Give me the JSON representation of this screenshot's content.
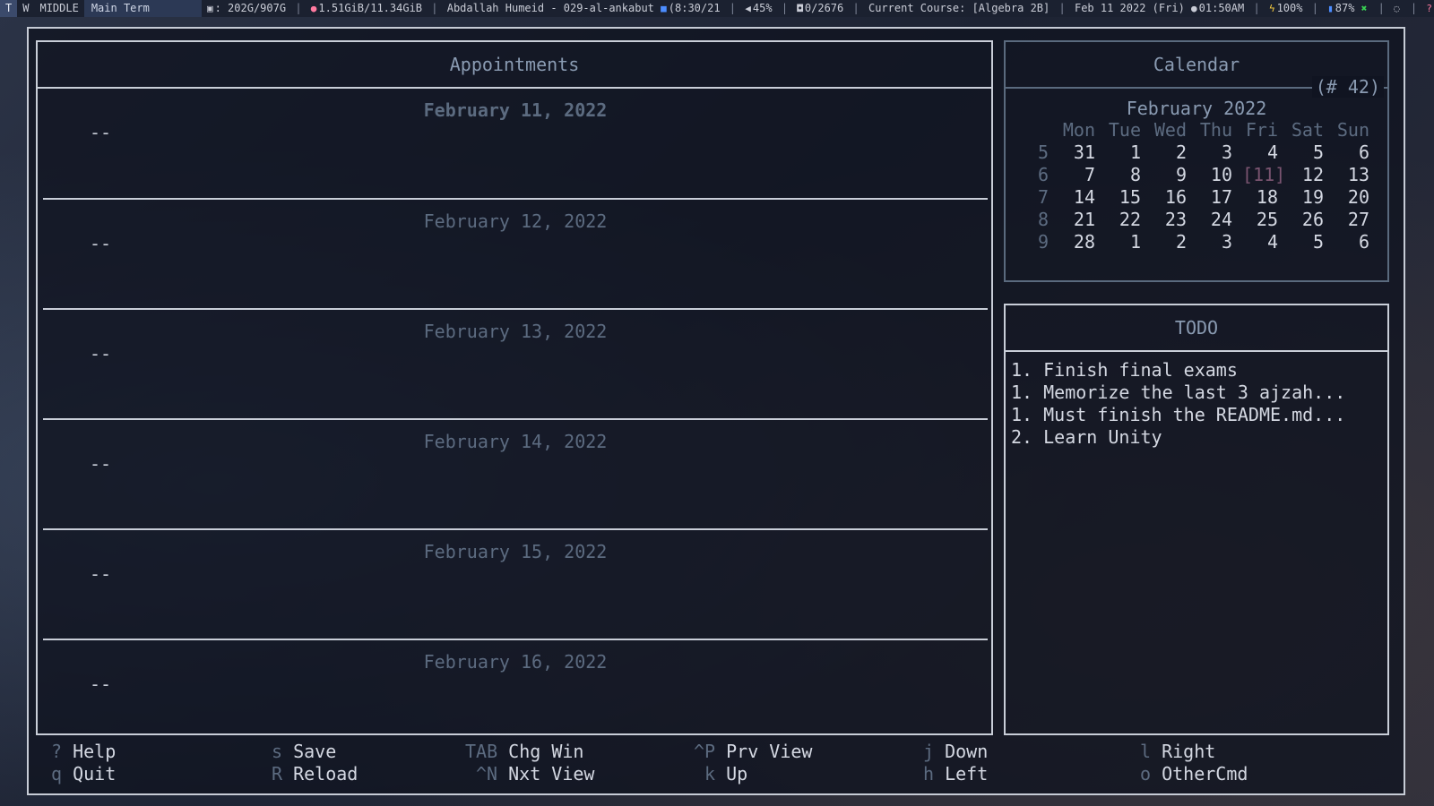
{
  "topbar": {
    "workspaces": [
      "T",
      "W",
      "MIDDLE"
    ],
    "window_title": "Main Term",
    "disk": ": 202G/907G",
    "memory": "1.51GiB/11.34GiB",
    "now_playing": "Abdallah Humeid - 029-al-ankabut",
    "track_time": "(8:30/21",
    "volume": "45%",
    "counter": "0/2676",
    "course": "Current Course: [Algebra 2B]",
    "date": "Feb 11 2022 (Fri)",
    "time": "01:50AM",
    "battery": "100%",
    "wifi": "87%",
    "separator": "|"
  },
  "appointments": {
    "title": "Appointments",
    "days": [
      {
        "date": "February 11, 2022",
        "entry": "--"
      },
      {
        "date": "February 12, 2022",
        "entry": "--"
      },
      {
        "date": "February 13, 2022",
        "entry": "--"
      },
      {
        "date": "February 14, 2022",
        "entry": "--"
      },
      {
        "date": "February 15, 2022",
        "entry": "--"
      },
      {
        "date": "February 16, 2022",
        "entry": "--"
      }
    ]
  },
  "calendar": {
    "title": "Calendar",
    "week_badge": "(# 42)",
    "month": "February 2022",
    "weekdays": [
      "Mon",
      "Tue",
      "Wed",
      "Thu",
      "Fri",
      "Sat",
      "Sun"
    ],
    "weeks": [
      {
        "num": "5",
        "days": [
          "31",
          "1",
          "2",
          "3",
          "4",
          "5",
          "6"
        ]
      },
      {
        "num": "6",
        "days": [
          "7",
          "8",
          "9",
          "10",
          "[11]",
          "12",
          "13"
        ]
      },
      {
        "num": "7",
        "days": [
          "14",
          "15",
          "16",
          "17",
          "18",
          "19",
          "20"
        ]
      },
      {
        "num": "8",
        "days": [
          "21",
          "22",
          "23",
          "24",
          "25",
          "26",
          "27"
        ]
      },
      {
        "num": "9",
        "days": [
          "28",
          "1",
          "2",
          "3",
          "4",
          "5",
          "6"
        ]
      }
    ]
  },
  "todo": {
    "title": "TODO",
    "items": [
      "1. Finish final exams",
      "1. Memorize the last 3 ajzah...",
      "1. Must finish the README.md...",
      "2. Learn Unity"
    ]
  },
  "footer": {
    "keys": [
      {
        "key": "?",
        "label": "Help"
      },
      {
        "key": "q",
        "label": "Quit"
      },
      {
        "key": "s",
        "label": "Save"
      },
      {
        "key": "R",
        "label": "Reload"
      },
      {
        "key": "TAB",
        "label": "Chg Win"
      },
      {
        "key": "^N",
        "label": "Nxt View"
      },
      {
        "key": "^P",
        "label": "Prv View"
      },
      {
        "key": "k",
        "label": "Up"
      },
      {
        "key": "j",
        "label": "Down"
      },
      {
        "key": "h",
        "label": "Left"
      },
      {
        "key": "l",
        "label": "Right"
      },
      {
        "key": "o",
        "label": "OtherCmd"
      }
    ]
  },
  "colors": {
    "border": "#c9ced8",
    "muted": "#5c6b80",
    "today": "#7a5470",
    "text": "#d4d8e2"
  }
}
